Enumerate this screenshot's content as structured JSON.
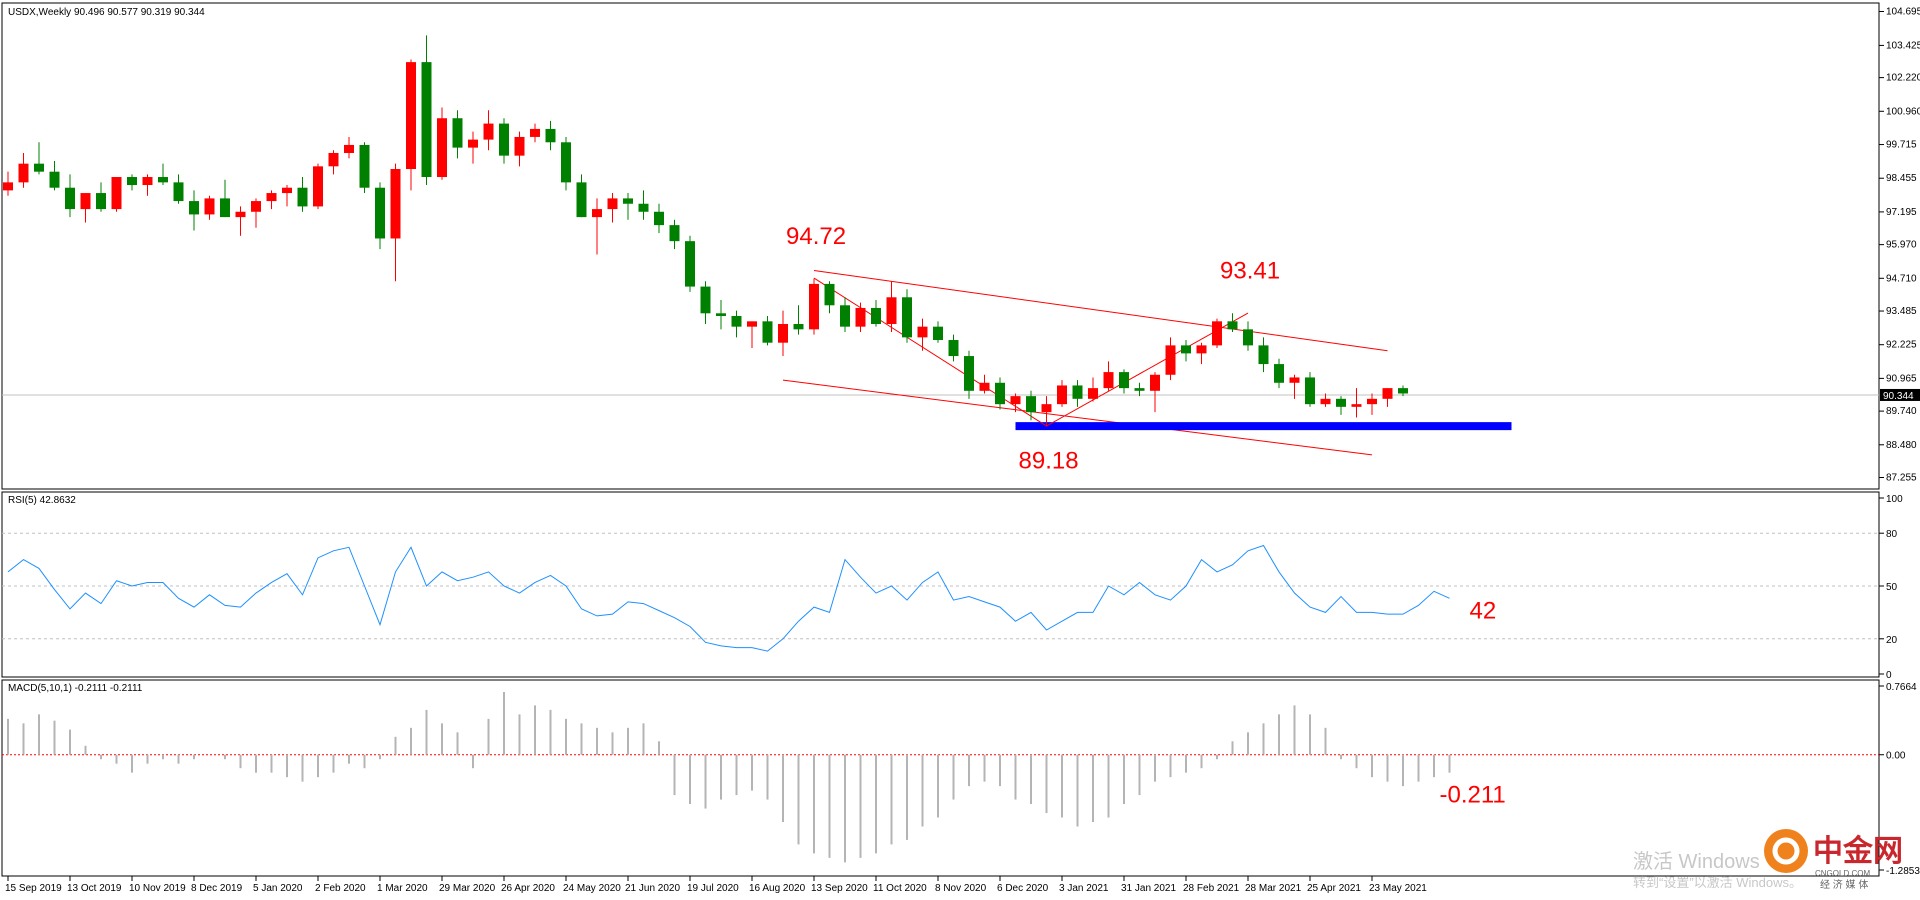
{
  "chart_data": [
    {
      "type": "candlestick",
      "symbol_label": "USDX,Weekly",
      "ohlc_label": "90.496 90.577 90.319 90.344",
      "current_price_label": "90.344",
      "y_tick_labels": [
        "104.695",
        "103.425",
        "102.220",
        "100.960",
        "99.715",
        "98.455",
        "97.195",
        "95.970",
        "94.710",
        "93.485",
        "92.225",
        "90.965",
        "89.740",
        "88.480",
        "87.255"
      ],
      "ylim": [
        86.9,
        104.9
      ],
      "x_tick_labels": [
        "15 Sep 2019",
        "13 Oct 2019",
        "10 Nov 2019",
        "8 Dec 2019",
        "5 Jan 2020",
        "2 Feb 2020",
        "1 Mar 2020",
        "29 Mar 2020",
        "26 Apr 2020",
        "24 May 2020",
        "21 Jun 2020",
        "19 Jul 2020",
        "16 Aug 2020",
        "13 Sep 2020",
        "11 Oct 2020",
        "8 Nov 2020",
        "6 Dec 2020",
        "3 Jan 2021",
        "31 Jan 2021",
        "28 Feb 2021",
        "28 Mar 2021",
        "25 Apr 2021",
        "23 May 2021"
      ],
      "candles": [
        {
          "o": 98.0,
          "h": 98.7,
          "l": 97.8,
          "c": 98.3
        },
        {
          "o": 98.3,
          "h": 99.4,
          "l": 98.1,
          "c": 99.0
        },
        {
          "o": 99.0,
          "h": 99.8,
          "l": 98.6,
          "c": 98.7
        },
        {
          "o": 98.7,
          "h": 99.1,
          "l": 98.0,
          "c": 98.1
        },
        {
          "o": 98.1,
          "h": 98.6,
          "l": 97.0,
          "c": 97.3
        },
        {
          "o": 97.3,
          "h": 97.8,
          "l": 96.8,
          "c": 97.9
        },
        {
          "o": 97.9,
          "h": 98.3,
          "l": 97.2,
          "c": 97.3
        },
        {
          "o": 97.3,
          "h": 98.5,
          "l": 97.2,
          "c": 98.5
        },
        {
          "o": 98.5,
          "h": 98.6,
          "l": 98.0,
          "c": 98.2
        },
        {
          "o": 98.2,
          "h": 98.6,
          "l": 97.8,
          "c": 98.5
        },
        {
          "o": 98.5,
          "h": 99.0,
          "l": 98.2,
          "c": 98.3
        },
        {
          "o": 98.3,
          "h": 98.6,
          "l": 97.5,
          "c": 97.6
        },
        {
          "o": 97.6,
          "h": 98.0,
          "l": 96.5,
          "c": 97.1
        },
        {
          "o": 97.1,
          "h": 97.8,
          "l": 96.9,
          "c": 97.7
        },
        {
          "o": 97.7,
          "h": 98.4,
          "l": 97.0,
          "c": 97.0
        },
        {
          "o": 97.0,
          "h": 97.4,
          "l": 96.3,
          "c": 97.2
        },
        {
          "o": 97.2,
          "h": 97.7,
          "l": 96.6,
          "c": 97.6
        },
        {
          "o": 97.6,
          "h": 98.0,
          "l": 97.3,
          "c": 97.9
        },
        {
          "o": 97.9,
          "h": 98.2,
          "l": 97.4,
          "c": 98.1
        },
        {
          "o": 98.1,
          "h": 98.5,
          "l": 97.2,
          "c": 97.4
        },
        {
          "o": 97.4,
          "h": 99.0,
          "l": 97.3,
          "c": 98.9
        },
        {
          "o": 98.9,
          "h": 99.5,
          "l": 98.6,
          "c": 99.4
        },
        {
          "o": 99.4,
          "h": 100.0,
          "l": 99.2,
          "c": 99.7
        },
        {
          "o": 99.7,
          "h": 99.8,
          "l": 97.9,
          "c": 98.1
        },
        {
          "o": 98.1,
          "h": 98.3,
          "l": 95.8,
          "c": 96.2
        },
        {
          "o": 96.2,
          "h": 99.0,
          "l": 94.6,
          "c": 98.8
        },
        {
          "o": 98.8,
          "h": 102.9,
          "l": 98.0,
          "c": 102.8
        },
        {
          "o": 102.8,
          "h": 103.8,
          "l": 98.2,
          "c": 98.5
        },
        {
          "o": 98.5,
          "h": 101.1,
          "l": 98.4,
          "c": 100.7
        },
        {
          "o": 100.7,
          "h": 101.0,
          "l": 99.2,
          "c": 99.6
        },
        {
          "o": 99.6,
          "h": 100.2,
          "l": 99.0,
          "c": 99.9
        },
        {
          "o": 99.9,
          "h": 101.0,
          "l": 99.5,
          "c": 100.5
        },
        {
          "o": 100.5,
          "h": 100.7,
          "l": 99.0,
          "c": 99.3
        },
        {
          "o": 99.3,
          "h": 100.2,
          "l": 98.9,
          "c": 100.0
        },
        {
          "o": 100.0,
          "h": 100.5,
          "l": 99.8,
          "c": 100.3
        },
        {
          "o": 100.3,
          "h": 100.6,
          "l": 99.5,
          "c": 99.8
        },
        {
          "o": 99.8,
          "h": 100.0,
          "l": 98.0,
          "c": 98.3
        },
        {
          "o": 98.3,
          "h": 98.6,
          "l": 97.0,
          "c": 97.0
        },
        {
          "o": 97.0,
          "h": 97.7,
          "l": 95.6,
          "c": 97.3
        },
        {
          "o": 97.3,
          "h": 97.9,
          "l": 96.8,
          "c": 97.7
        },
        {
          "o": 97.7,
          "h": 97.9,
          "l": 96.9,
          "c": 97.5
        },
        {
          "o": 97.5,
          "h": 98.0,
          "l": 96.9,
          "c": 97.2
        },
        {
          "o": 97.2,
          "h": 97.5,
          "l": 96.4,
          "c": 96.7
        },
        {
          "o": 96.7,
          "h": 96.9,
          "l": 95.8,
          "c": 96.1
        },
        {
          "o": 96.1,
          "h": 96.3,
          "l": 94.2,
          "c": 94.4
        },
        {
          "o": 94.4,
          "h": 94.6,
          "l": 93.0,
          "c": 93.4
        },
        {
          "o": 93.4,
          "h": 93.9,
          "l": 92.8,
          "c": 93.3
        },
        {
          "o": 93.3,
          "h": 93.5,
          "l": 92.5,
          "c": 92.9
        },
        {
          "o": 92.9,
          "h": 93.1,
          "l": 92.1,
          "c": 93.1
        },
        {
          "o": 93.1,
          "h": 93.3,
          "l": 92.2,
          "c": 92.3
        },
        {
          "o": 92.3,
          "h": 93.5,
          "l": 91.8,
          "c": 93.0
        },
        {
          "o": 93.0,
          "h": 93.7,
          "l": 92.6,
          "c": 92.8
        },
        {
          "o": 92.8,
          "h": 94.7,
          "l": 92.6,
          "c": 94.5
        },
        {
          "o": 94.5,
          "h": 94.6,
          "l": 93.4,
          "c": 93.7
        },
        {
          "o": 93.7,
          "h": 94.0,
          "l": 92.7,
          "c": 92.9
        },
        {
          "o": 92.9,
          "h": 93.8,
          "l": 92.7,
          "c": 93.6
        },
        {
          "o": 93.6,
          "h": 93.9,
          "l": 92.9,
          "c": 93.0
        },
        {
          "o": 93.0,
          "h": 94.6,
          "l": 92.7,
          "c": 94.0
        },
        {
          "o": 94.0,
          "h": 94.3,
          "l": 92.3,
          "c": 92.5
        },
        {
          "o": 92.5,
          "h": 93.2,
          "l": 92.0,
          "c": 92.9
        },
        {
          "o": 92.9,
          "h": 93.1,
          "l": 92.3,
          "c": 92.4
        },
        {
          "o": 92.4,
          "h": 92.6,
          "l": 91.6,
          "c": 91.8
        },
        {
          "o": 91.8,
          "h": 92.0,
          "l": 90.2,
          "c": 90.5
        },
        {
          "o": 90.5,
          "h": 91.1,
          "l": 90.4,
          "c": 90.8
        },
        {
          "o": 90.8,
          "h": 91.0,
          "l": 89.8,
          "c": 90.0
        },
        {
          "o": 90.0,
          "h": 90.4,
          "l": 89.7,
          "c": 90.3
        },
        {
          "o": 90.3,
          "h": 90.5,
          "l": 89.4,
          "c": 89.7
        },
        {
          "o": 89.7,
          "h": 90.3,
          "l": 89.2,
          "c": 90.0
        },
        {
          "o": 90.0,
          "h": 90.9,
          "l": 89.9,
          "c": 90.7
        },
        {
          "o": 90.7,
          "h": 90.9,
          "l": 89.9,
          "c": 90.2
        },
        {
          "o": 90.2,
          "h": 91.0,
          "l": 90.1,
          "c": 90.6
        },
        {
          "o": 90.6,
          "h": 91.6,
          "l": 90.5,
          "c": 91.2
        },
        {
          "o": 91.2,
          "h": 91.3,
          "l": 90.4,
          "c": 90.6
        },
        {
          "o": 90.6,
          "h": 90.8,
          "l": 90.3,
          "c": 90.5
        },
        {
          "o": 90.5,
          "h": 91.2,
          "l": 89.7,
          "c": 91.1
        },
        {
          "o": 91.1,
          "h": 92.5,
          "l": 90.9,
          "c": 92.2
        },
        {
          "o": 92.2,
          "h": 92.4,
          "l": 91.6,
          "c": 91.9
        },
        {
          "o": 91.9,
          "h": 92.3,
          "l": 91.5,
          "c": 92.2
        },
        {
          "o": 92.2,
          "h": 93.2,
          "l": 92.1,
          "c": 93.1
        },
        {
          "o": 93.1,
          "h": 93.4,
          "l": 92.7,
          "c": 92.8
        },
        {
          "o": 92.8,
          "h": 93.1,
          "l": 92.0,
          "c": 92.2
        },
        {
          "o": 92.2,
          "h": 92.5,
          "l": 91.2,
          "c": 91.5
        },
        {
          "o": 91.5,
          "h": 91.7,
          "l": 90.6,
          "c": 90.8
        },
        {
          "o": 90.8,
          "h": 91.1,
          "l": 90.2,
          "c": 91.0
        },
        {
          "o": 91.0,
          "h": 91.2,
          "l": 89.9,
          "c": 90.0
        },
        {
          "o": 90.0,
          "h": 90.4,
          "l": 89.9,
          "c": 90.2
        },
        {
          "o": 90.2,
          "h": 90.3,
          "l": 89.6,
          "c": 89.9
        },
        {
          "o": 89.9,
          "h": 90.6,
          "l": 89.5,
          "c": 90.0
        },
        {
          "o": 90.0,
          "h": 90.4,
          "l": 89.6,
          "c": 90.2
        },
        {
          "o": 90.2,
          "h": 90.6,
          "l": 89.9,
          "c": 90.6
        },
        {
          "o": 90.6,
          "h": 90.7,
          "l": 90.3,
          "c": 90.4
        }
      ],
      "colors": {
        "bull": "#ff0000",
        "bear": "#008000",
        "channel": "#ff0000",
        "support": "#0000ff",
        "grid": "#c0c0c0"
      },
      "channel_lines": [
        {
          "from": [
            52,
            95.0
          ],
          "to": [
            89,
            92.0
          ]
        },
        {
          "from": [
            50,
            90.9
          ],
          "to": [
            88,
            88.1
          ]
        }
      ],
      "support_level": {
        "value": 89.18,
        "from": 65,
        "to": 97
      },
      "zigzag": [
        {
          "i": 52,
          "v": 94.72
        },
        {
          "i": 67,
          "v": 89.18
        },
        {
          "i": 80,
          "v": 93.41
        }
      ],
      "annotations": [
        {
          "text": "94.72",
          "i": 52,
          "v": 96.0
        },
        {
          "text": "93.41",
          "i": 80,
          "v": 94.7
        },
        {
          "text": "89.18",
          "i": 67,
          "v": 87.6
        }
      ]
    },
    {
      "type": "line",
      "label": "RSI(5) 42.8632",
      "y_tick_labels": [
        "100",
        "80",
        "50",
        "20",
        "0"
      ],
      "levels": [
        80,
        50,
        20
      ],
      "ylim": [
        0,
        100
      ],
      "color": "#1e90ff",
      "values": [
        58,
        65,
        60,
        48,
        37,
        46,
        40,
        53,
        50,
        52,
        52,
        43,
        38,
        45,
        39,
        38,
        46,
        52,
        57,
        45,
        66,
        70,
        72,
        50,
        28,
        58,
        72,
        50,
        58,
        53,
        55,
        58,
        50,
        46,
        52,
        56,
        50,
        37,
        33,
        34,
        41,
        40,
        36,
        32,
        27,
        18,
        16,
        15,
        15,
        13,
        20,
        30,
        38,
        35,
        65,
        55,
        46,
        50,
        42,
        52,
        58,
        42,
        44,
        41,
        38,
        30,
        35,
        25,
        30,
        35,
        35,
        50,
        45,
        52,
        45,
        42,
        50,
        65,
        58,
        62,
        70,
        73,
        58,
        46,
        38,
        35,
        44,
        35,
        35,
        34,
        34,
        39,
        47,
        43
      ],
      "annotation": "42"
    },
    {
      "type": "bar",
      "label": "MACD(5,10,1) -0.2111 -0.2111",
      "y_tick_labels": [
        "0.7664",
        "0.00",
        "-1.2853"
      ],
      "ylim": [
        -1.2853,
        0.7664
      ],
      "color": "#b4b4b4",
      "zero_line_color": "#ff0000",
      "values": [
        0.4,
        0.35,
        0.45,
        0.38,
        0.28,
        0.1,
        -0.05,
        -0.1,
        -0.2,
        -0.1,
        -0.05,
        -0.1,
        -0.05,
        0.0,
        -0.05,
        -0.15,
        -0.2,
        -0.2,
        -0.25,
        -0.3,
        -0.25,
        -0.2,
        -0.1,
        -0.15,
        -0.05,
        0.2,
        0.3,
        0.5,
        0.35,
        0.25,
        -0.15,
        0.4,
        0.7,
        0.45,
        0.55,
        0.5,
        0.4,
        0.35,
        0.3,
        0.25,
        0.3,
        0.35,
        0.15,
        -0.45,
        -0.55,
        -0.6,
        -0.5,
        -0.45,
        -0.4,
        -0.5,
        -0.75,
        -1.0,
        -1.1,
        -1.15,
        -1.2,
        -1.15,
        -1.1,
        -1.0,
        -0.95,
        -0.8,
        -0.7,
        -0.5,
        -0.35,
        -0.3,
        -0.35,
        -0.5,
        -0.55,
        -0.65,
        -0.7,
        -0.8,
        -0.75,
        -0.7,
        -0.55,
        -0.45,
        -0.3,
        -0.25,
        -0.2,
        -0.15,
        -0.05,
        0.15,
        0.25,
        0.35,
        0.45,
        0.55,
        0.45,
        0.3,
        -0.05,
        -0.15,
        -0.25,
        -0.3,
        -0.35,
        -0.3,
        -0.25,
        -0.2
      ],
      "annotation": "-0.211"
    }
  ],
  "watermark": {
    "windows_line1": "激活 Windows",
    "windows_line2": "转到“设置”以激活 Windows。",
    "brand": "中金网",
    "brand_url": "CNGOLD.COM",
    "brand_sub": "经 济 媒 体"
  }
}
